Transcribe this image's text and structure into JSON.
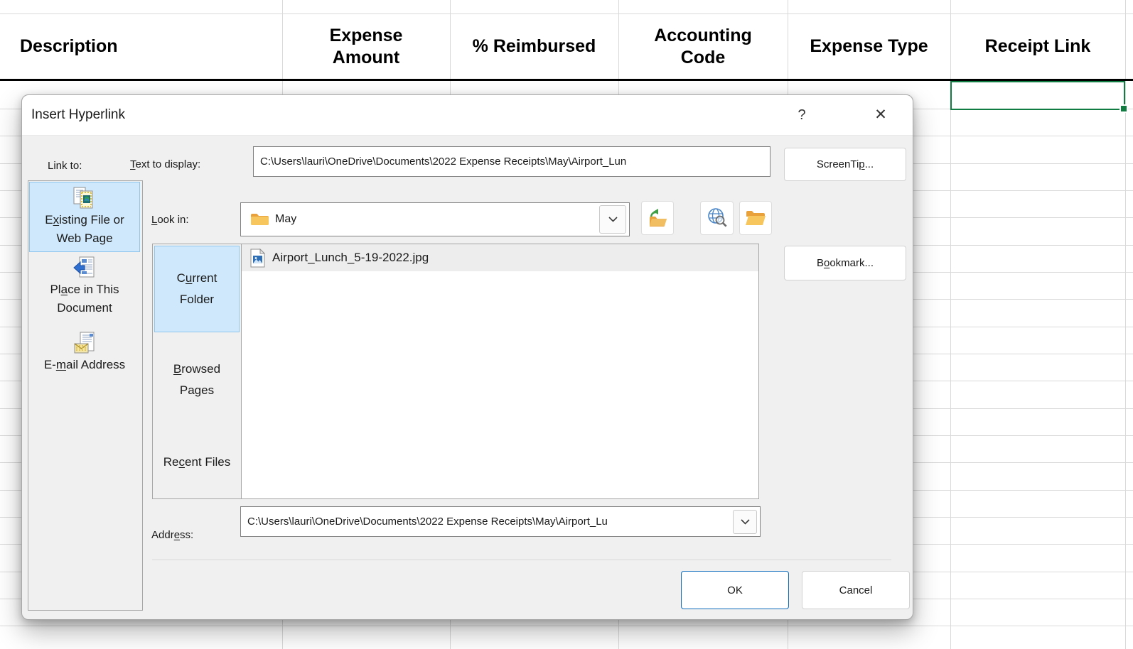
{
  "sheet": {
    "headers": [
      "Description",
      "Expense Amount",
      "% Reimbursed",
      "Accounting Code",
      "Expense Type",
      "Receipt Link"
    ],
    "selection_color": "#107c41"
  },
  "dialog": {
    "title": "Insert Hyperlink",
    "help_glyph": "?",
    "close_glyph": "✕",
    "link_to_label": "Link to:",
    "text_to_display_label": {
      "pre": "",
      "key": "T",
      "post": "ext to display:"
    },
    "text_to_display_value": "C:\\Users\\lauri\\OneDrive\\Documents\\2022 Expense Receipts\\May\\Airport_Lun",
    "screentip_button": {
      "pre": "ScreenTi",
      "key": "p",
      "post": "..."
    },
    "link_to_items": [
      {
        "icon": "existing-file-or-web-page-icon",
        "line1": {
          "pre": "E",
          "key": "x",
          "post": "isting File or"
        },
        "line2": "Web Page",
        "selected": true
      },
      {
        "icon": "place-in-this-document-icon",
        "line1": {
          "pre": "Pl",
          "key": "a",
          "post": "ce in This"
        },
        "line2": "Document",
        "selected": false
      },
      {
        "icon": "email-address-icon",
        "line1": {
          "pre": "E-",
          "key": "m",
          "post": "ail Address"
        },
        "line2": "",
        "selected": false
      }
    ],
    "look_in_label": {
      "pre": "",
      "key": "L",
      "post": "ook in:"
    },
    "look_in_value": "May",
    "toolbar_icons": [
      "up-one-folder-icon",
      "browse-the-web-icon",
      "browse-for-file-icon"
    ],
    "categories": [
      {
        "line1": {
          "pre": "C",
          "key": "u",
          "post": "rrent"
        },
        "line2": "Folder",
        "selected": true
      },
      {
        "line1": {
          "pre": "",
          "key": "B",
          "post": "rowsed"
        },
        "line2": "Pages",
        "selected": false
      },
      {
        "line1": {
          "pre": "Re",
          "key": "c",
          "post": "ent Files"
        },
        "line2": "",
        "selected": false
      }
    ],
    "files": [
      {
        "name": "Airport_Lunch_5-19-2022.jpg",
        "icon": "image-file-icon"
      }
    ],
    "bookmark_button": {
      "pre": "B",
      "key": "o",
      "post": "okmark..."
    },
    "address_label": {
      "pre": "Addr",
      "key": "e",
      "post": "ss:"
    },
    "address_value": "C:\\Users\\lauri\\OneDrive\\Documents\\2022 Expense Receipts\\May\\Airport_Lu",
    "ok_button": "OK",
    "cancel_button": "Cancel"
  }
}
